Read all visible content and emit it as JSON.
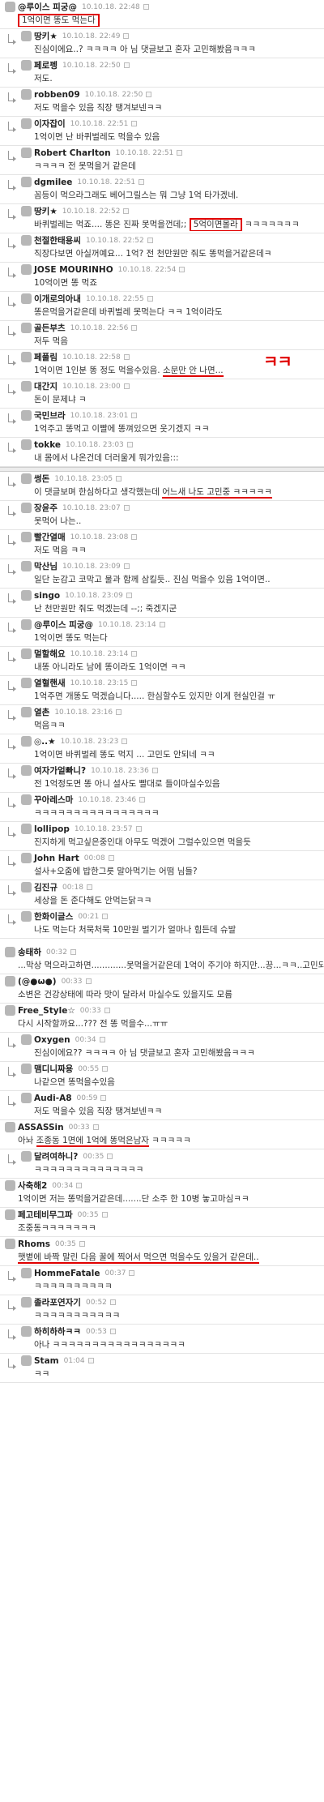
{
  "c1": {
    "name": "@루이스 피궁@",
    "time": "10.10.18. 22:48",
    "text": "1억이면 똥도 먹는다"
  },
  "c2": {
    "name": "땅키★",
    "time": "10.10.18. 22:49",
    "text": "진심이에요..? ㅋㅋㅋㅋ 아 님 댓글보고 혼자 고민해봤음ㅋㅋㅋ"
  },
  "c3": {
    "name": "페로펭",
    "time": "10.10.18. 22:50",
    "text": "저도."
  },
  "c4": {
    "name": "robben09",
    "time": "10.10.18. 22:50",
    "text": "저도 먹을수 있음 직장 땡겨보넨ㅋㅋ"
  },
  "c5": {
    "name": "이자잡이",
    "time": "10.10.18. 22:51",
    "text": "1억이면 난 바퀴벌레도 먹을수 있음"
  },
  "c6": {
    "name": "Robert Charlton",
    "time": "10.10.18. 22:51",
    "text": "ㅋㅋㅋㅋ 전 못먹을거 같은데"
  },
  "c7": {
    "name": "dgmilee",
    "time": "10.10.18. 22:51",
    "text": "꼼등이 먹으라그래도 베어그릴스는 뭐 그냥 1억 타가겠네."
  },
  "c8": {
    "name": "땅키★",
    "time": "10.10.18. 22:52",
    "pre": "바퀴벌레는 먹죠.... 똥은 진짜 못먹을껀데;; ",
    "hl": "5억이면몰라",
    "post": " ㅋㅋㅋㅋㅋㅋㅋ"
  },
  "c9": {
    "name": "천절한태용씨",
    "time": "10.10.18. 22:52",
    "text": "직장다보면 아실꺼예요... 1억? 전 천만원만 줘도 똥먹을거같은데ㅋ"
  },
  "c10": {
    "name": "JOSE MOURINHO",
    "time": "10.10.18. 22:54",
    "text": "10억이면 똥 먹죠"
  },
  "c11": {
    "name": "이개로의아내",
    "time": "10.10.18. 22:55",
    "text": "똥은먹을거같은데 바퀴벌레 못먹는다 ㅋㅋ 1억이라도"
  },
  "c12": {
    "name": "골든부츠",
    "time": "10.10.18. 22:56",
    "text": "저두 먹음"
  },
  "c13": {
    "name": "페풀림",
    "time": "10.10.18. 22:58",
    "pre": "1억이면 1인분 똥 정도 먹을수있음. ",
    "hl": "소문만 안 나면...",
    "mark": "ㅋㅋ"
  },
  "c14": {
    "name": "대간지",
    "time": "10.10.18. 23:00",
    "text": "돈이 문제냐 ㅋ"
  },
  "c15": {
    "name": "국민브라",
    "time": "10.10.18. 23:01",
    "text": "1억주고 똥먹고 이빨에 똥껴있으면 웃기겠지 ㅋㅋ"
  },
  "c16": {
    "name": "tokke",
    "time": "10.10.18. 23:03",
    "text": "내 몸에서 나온건데 더러울게 뭐가있음:::"
  },
  "c17": {
    "name": "썽돈",
    "time": "10.10.18. 23:05",
    "pre": "이 댓글보며 한심하다고 생각했는데 ",
    "hl": "어느새 나도 고민중 ㅋㅋㅋㅋㅋ"
  },
  "c18": {
    "name": "장윤주",
    "time": "10.10.18. 23:07",
    "text": "못먹어 나는.."
  },
  "c19": {
    "name": "빨간열매",
    "time": "10.10.18. 23:08",
    "text": "저도 먹음 ㅋㅋ"
  },
  "c20": {
    "name": "막산님",
    "time": "10.10.18. 23:09",
    "text": "일단 눈감고 코막고 물과 함께 삼킬듯.. 진심 먹을수 있음 1억이면.."
  },
  "c21": {
    "name": "singo",
    "time": "10.10.18. 23:09",
    "text": "난 천만원만 줘도 먹겠는데 --;; 죽겠지군"
  },
  "c22": {
    "name": "@루이스 피궁@",
    "time": "10.10.18. 23:14",
    "text": "1억이면 똥도 먹는다"
  },
  "c23": {
    "name": "멀할해요",
    "time": "10.10.18. 23:14",
    "text": "내똥 아니라도 남에 똥이라도 1억이면 ㅋㅋ"
  },
  "c24": {
    "name": "열혈핸새",
    "time": "10.10.18. 23:15",
    "text": "1억주면 개똥도 먹겠습니다..... 한심할수도 있지만 이게 현실인걸 ㅠ"
  },
  "c25": {
    "name": "열촌",
    "time": "10.10.18. 23:16",
    "text": "먹음ㅋㅋ"
  },
  "c26": {
    "name": "◎..★",
    "time": "10.10.18. 23:23",
    "text": "1억이면 바퀴벌레 똥도 먹지 ... 고민도 안되네 ㅋㅋ"
  },
  "c27": {
    "name": "여자가얼빠니?",
    "time": "10.10.18. 23:36",
    "text": "전 1억정도면 똥 아니 설사도 빨대로 들이마실수있음"
  },
  "c28": {
    "name": "꾸아레스마",
    "time": "10.10.18. 23:46",
    "text": "ㅋㅋㅋㅋㅋㅋㅋㅋㅋㅋㅋㅋㅋㅋㅋㅋ"
  },
  "c29": {
    "name": "lollipop",
    "time": "10.10.18. 23:57",
    "text": "진지하게 먹고싶은중인대 아무도 먹겠어 그럴수있으면 먹을듯"
  },
  "c30": {
    "name": "John Hart",
    "time": "00:08",
    "text": "설사+오줌에 밥한그릇 말아먹기는 어떰 님들?"
  },
  "c31": {
    "name": "김진규",
    "time": "00:18",
    "text": "세상을 돈 준다해도 안먹는닭ㅋㅋ"
  },
  "c32": {
    "name": "한화이글스",
    "time": "00:21",
    "text": "나도 먹는다 처묵처묵 10만원 벌기가 얼마나 힘든데 슈발"
  },
  "c33": {
    "name": "송태하",
    "time": "00:32",
    "text": "...막상 먹으라고하면.............못먹을거같은데 1억이 주기야 하지만...끙...ㅋㅋ..고민되네"
  },
  "c34": {
    "name": "(@●ω●)",
    "time": "00:33",
    "text": "소변은 건강상태에 따라 맛이 달라서 마실수도 있을지도 모름"
  },
  "c35": {
    "name": "Free_Style☆",
    "time": "00:33",
    "text": "다시 시작할까요...??? 전 똥 먹을수...ㅠㅠ"
  },
  "c36": {
    "name": "Oxygen",
    "time": "00:34",
    "text": "진심이에요?? ㅋㅋㅋㅋ 아 님 댓글보고 혼자 고민해봤음ㅋㅋㅋ"
  },
  "c37": {
    "name": "맴디니짜용",
    "time": "00:55",
    "text": "나같으면 똥먹을수있음"
  },
  "c38": {
    "name": "Audi-A8",
    "time": "00:59",
    "text": "저도 먹을수 있음 직장 땡겨보넨ㅋㅋ"
  },
  "c39": {
    "name": "ASSASSin",
    "time": "00:33",
    "pre": "아놔 ",
    "hl": "조종동 1면에 1억에 똥먹은남자",
    "post": " ㅋㅋㅋㅋㅋ"
  },
  "c40": {
    "name": "달려여하니?",
    "time": "00:35",
    "text": "ㅋㅋㅋㅋㅋㅋㅋㅋㅋㅋㅋㅋㅋㅋ"
  },
  "c41": {
    "name": "사축해2",
    "time": "00:34",
    "text": "1억이면 저는 똥먹을거같은데.......단 소주 한 10병 놓고마심ㅋㅋ"
  },
  "c42": {
    "name": "페고테비무그파",
    "time": "00:35",
    "text": "조중동ㅋㅋㅋㅋㅋㅋㅋ"
  },
  "c43": {
    "name": "Rhoms",
    "time": "00:35",
    "hl": "햇볕에 바짝 말린 다음 꿀에 찍어서 먹으면 먹을수도 있을거 같은데.."
  },
  "c44": {
    "name": "HommeFatale",
    "time": "00:37",
    "text": "ㅋㅋㅋㅋㅋㅋㅋㅋㅋㅋ"
  },
  "c45": {
    "name": "졸라포연자기",
    "time": "00:52",
    "text": "ㅋㅋㅋㅋㅋㅋㅋㅋㅋㅋㅋ"
  },
  "c46": {
    "name": "하히하하ㅋㅋ",
    "time": "00:53",
    "text": "아나 ㅋㅋㅋㅋㅋㅋㅋㅋㅋㅋㅋㅋㅋㅋㅋㅋㅋ"
  },
  "c47": {
    "name": "Stam",
    "time": "01:04",
    "text": "ㅋㅋ"
  }
}
